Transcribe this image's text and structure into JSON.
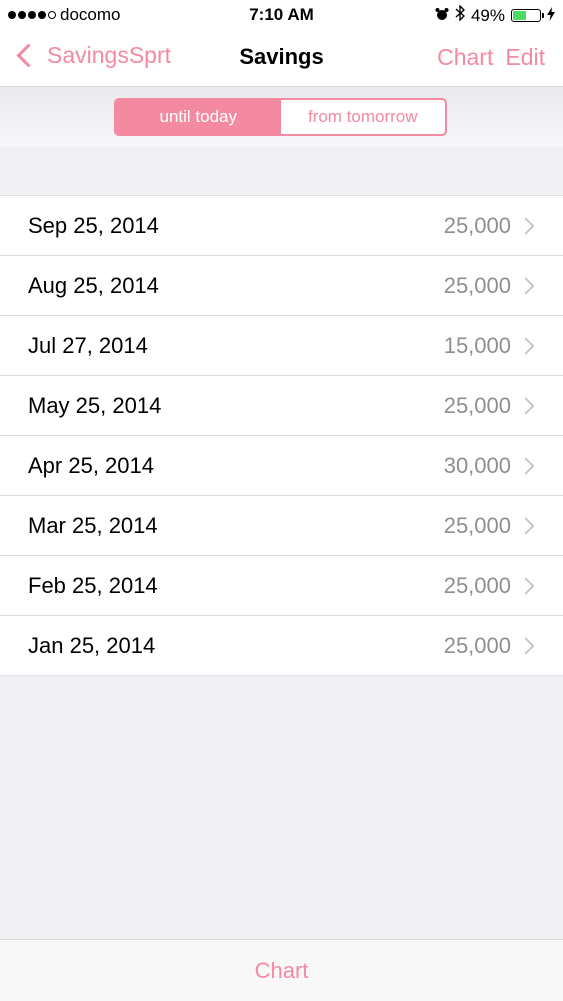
{
  "status_bar": {
    "carrier": "docomo",
    "time": "7:10 AM",
    "battery": "49%",
    "battery_level": 0.49
  },
  "nav": {
    "back_label": "SavingsSprt",
    "title": "Savings",
    "chart_label": "Chart",
    "edit_label": "Edit"
  },
  "segments": {
    "until_today": "until today",
    "from_tomorrow": "from tomorrow",
    "selected": "until today"
  },
  "entries": [
    {
      "date": "Sep 25, 2014",
      "amount": "25,000"
    },
    {
      "date": "Aug 25, 2014",
      "amount": "25,000"
    },
    {
      "date": "Jul 27, 2014",
      "amount": "15,000"
    },
    {
      "date": "May 25, 2014",
      "amount": "25,000"
    },
    {
      "date": "Apr 25, 2014",
      "amount": "30,000"
    },
    {
      "date": "Mar 25, 2014",
      "amount": "25,000"
    },
    {
      "date": "Feb 25, 2014",
      "amount": "25,000"
    },
    {
      "date": "Jan 25, 2014",
      "amount": "25,000"
    }
  ],
  "tab_bar": {
    "chart_label": "Chart"
  },
  "colors": {
    "accent": "#f48aa2",
    "background": "#efeff4",
    "secondary_text": "#8e8e93"
  }
}
